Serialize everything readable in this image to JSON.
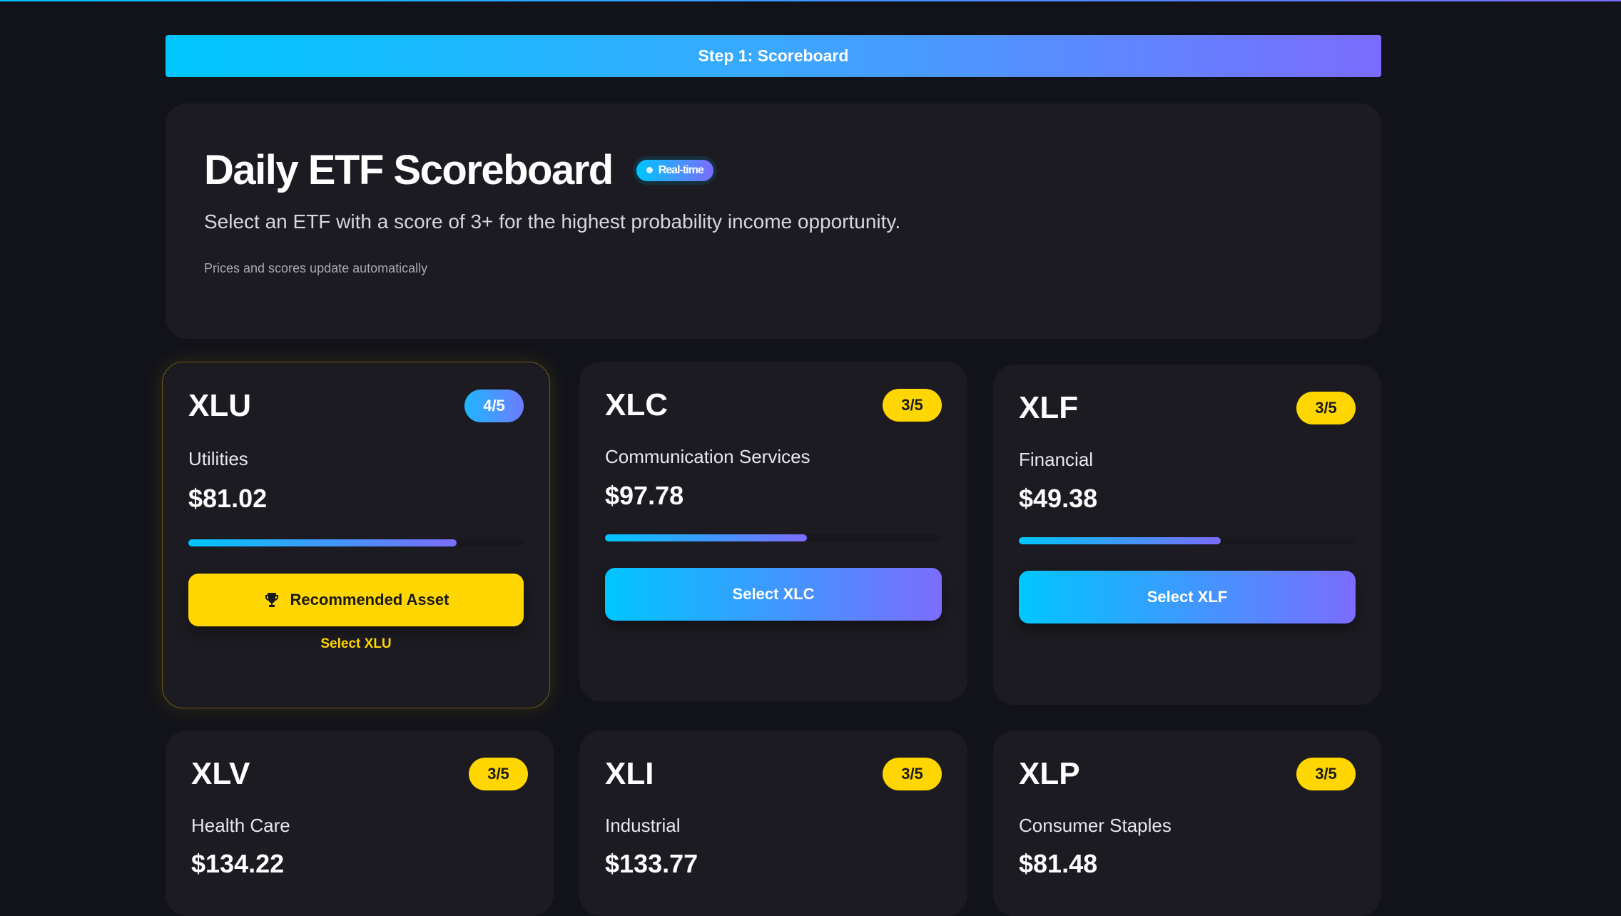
{
  "step_bar": {
    "label": "Step 1: Scoreboard"
  },
  "hero": {
    "title": "Daily ETF Scoreboard",
    "badge": "Real-time",
    "subtitle": "Select an ETF with a score of 3+ for the highest probability income opportunity.",
    "note": "Prices and scores update automatically"
  },
  "colors": {
    "background": "#12131a",
    "card": "#1b1b21",
    "accent_start": "#00c6ff",
    "accent_end": "#7b6cff",
    "highlight_yellow": "#ffd600"
  },
  "etfs": [
    {
      "ticker": "XLU",
      "sector": "Utilities",
      "price": "$81.02",
      "score": "4/5",
      "score_fraction": 0.8,
      "featured": true,
      "button": "Recommended Asset",
      "button_icon": "trophy-icon",
      "select_link": "Select XLU"
    },
    {
      "ticker": "XLC",
      "sector": "Communication Services",
      "price": "$97.78",
      "score": "3/5",
      "score_fraction": 0.6,
      "featured": false,
      "button": "Select XLC"
    },
    {
      "ticker": "XLF",
      "sector": "Financial",
      "price": "$49.38",
      "score": "3/5",
      "score_fraction": 0.6,
      "featured": false,
      "button": "Select XLF"
    },
    {
      "ticker": "XLV",
      "sector": "Health Care",
      "price": "$134.22",
      "score": "3/5"
    },
    {
      "ticker": "XLI",
      "sector": "Industrial",
      "price": "$133.77",
      "score": "3/5"
    },
    {
      "ticker": "XLP",
      "sector": "Consumer Staples",
      "price": "$81.48",
      "score": "3/5"
    }
  ]
}
